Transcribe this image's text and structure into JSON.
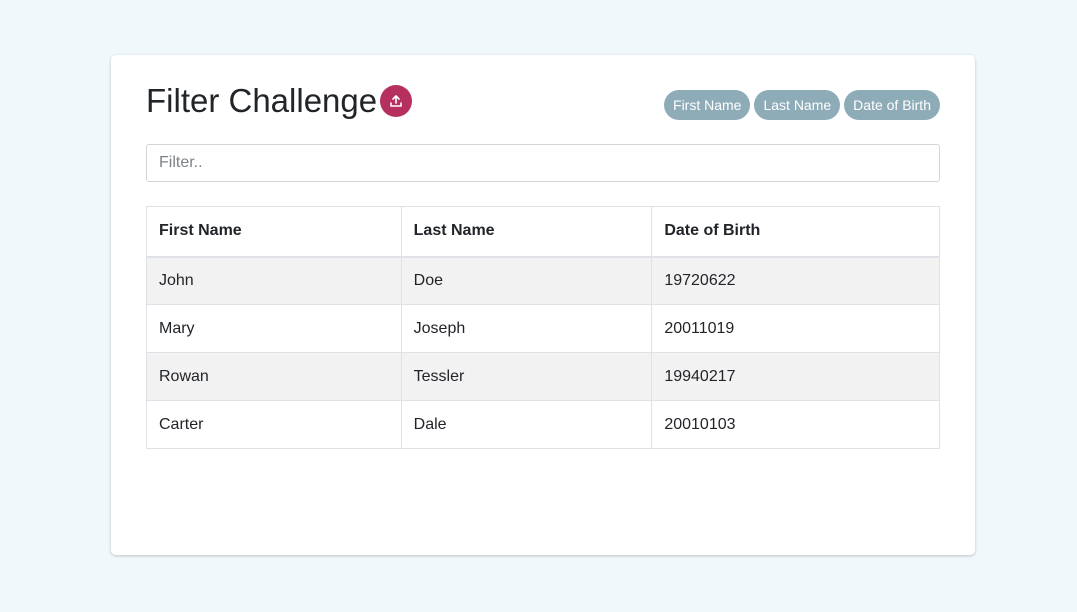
{
  "header": {
    "title": "Filter Challenge",
    "upload_icon": "upload-icon",
    "sort_chips": [
      "First Name",
      "Last Name",
      "Date of Birth"
    ]
  },
  "filter": {
    "placeholder": "Filter..",
    "value": ""
  },
  "table": {
    "columns": [
      "First Name",
      "Last Name",
      "Date of Birth"
    ],
    "rows": [
      [
        "John",
        "Doe",
        "19720622"
      ],
      [
        "Mary",
        "Joseph",
        "20011019"
      ],
      [
        "Rowan",
        "Tessler",
        "19940217"
      ],
      [
        "Carter",
        "Dale",
        "20010103"
      ]
    ]
  },
  "colors": {
    "page_background": "#f1f8fb",
    "accent_button": "#b6305f",
    "chip_background": "#8eacb8",
    "striped_row": "#f2f2f2"
  }
}
